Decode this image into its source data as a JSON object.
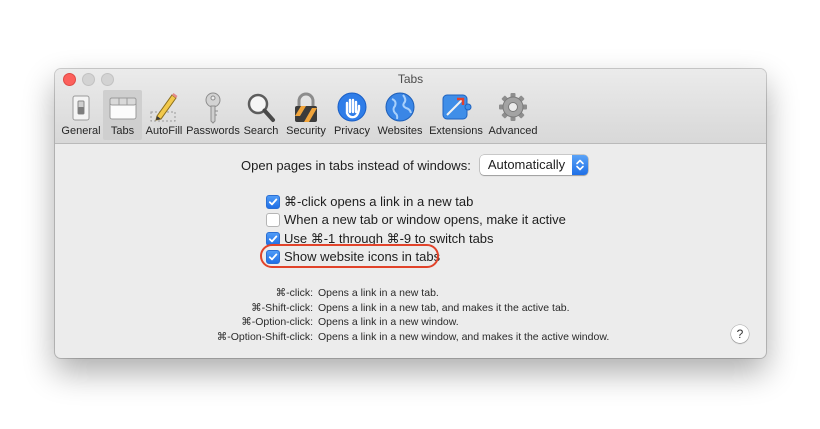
{
  "window": {
    "title": "Tabs"
  },
  "toolbar": {
    "items": [
      {
        "label": "General",
        "icon": "switch-icon"
      },
      {
        "label": "Tabs",
        "icon": "tabs-icon",
        "selected": true
      },
      {
        "label": "AutoFill",
        "icon": "pencil-icon"
      },
      {
        "label": "Passwords",
        "icon": "key-icon"
      },
      {
        "label": "Search",
        "icon": "magnifier-icon"
      },
      {
        "label": "Security",
        "icon": "lock-icon"
      },
      {
        "label": "Privacy",
        "icon": "hand-icon"
      },
      {
        "label": "Websites",
        "icon": "globe-icon"
      },
      {
        "label": "Extensions",
        "icon": "puzzle-icon"
      },
      {
        "label": "Advanced",
        "icon": "gear-icon"
      }
    ]
  },
  "open_pages": {
    "label": "Open pages in tabs instead of windows:",
    "value": "Automatically"
  },
  "checkboxes": [
    {
      "label": "⌘-click opens a link in a new tab",
      "checked": true
    },
    {
      "label": "When a new tab or window opens, make it active",
      "checked": false
    },
    {
      "label": "Use ⌘-1 through ⌘-9 to switch tabs",
      "checked": true
    },
    {
      "label": "Show website icons in tabs",
      "checked": true
    }
  ],
  "shortcuts": [
    {
      "key": "⌘-click:",
      "desc": "Opens a link in a new tab."
    },
    {
      "key": "⌘-Shift-click:",
      "desc": "Opens a link in a new tab, and makes it the active tab."
    },
    {
      "key": "⌘-Option-click:",
      "desc": "Opens a link in a new window."
    },
    {
      "key": "⌘-Option-Shift-click:",
      "desc": "Opens a link in a new window, and makes it the active window."
    }
  ],
  "help": {
    "label": "?"
  },
  "colors": {
    "accent": "#2b7bf0",
    "annotation": "#e1432a",
    "window_bg": "#ececec"
  }
}
